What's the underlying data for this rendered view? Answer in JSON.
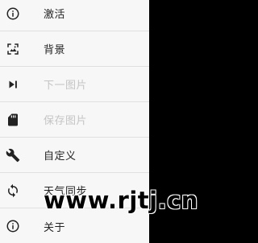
{
  "menu": {
    "items": [
      {
        "label": "激活",
        "icon": "info-icon",
        "disabled": false
      },
      {
        "label": "背景",
        "icon": "wallpaper-icon",
        "disabled": false
      },
      {
        "label": "下一图片",
        "icon": "skip-next-icon",
        "disabled": true
      },
      {
        "label": "保存图片",
        "icon": "sd-card-icon",
        "disabled": true
      },
      {
        "label": "自定义",
        "icon": "wrench-icon",
        "disabled": false
      },
      {
        "label": "天气同步",
        "icon": "sync-icon",
        "disabled": false
      },
      {
        "label": "关于",
        "icon": "info-icon",
        "disabled": false
      }
    ]
  },
  "watermark": {
    "text": "www.rjtj.cn"
  },
  "colors": {
    "panel_background": "#f7f7f7",
    "overlay": "#000000",
    "text": "#222222",
    "disabled_text": "#c4c4c4",
    "divider": "#e0e0e0"
  }
}
